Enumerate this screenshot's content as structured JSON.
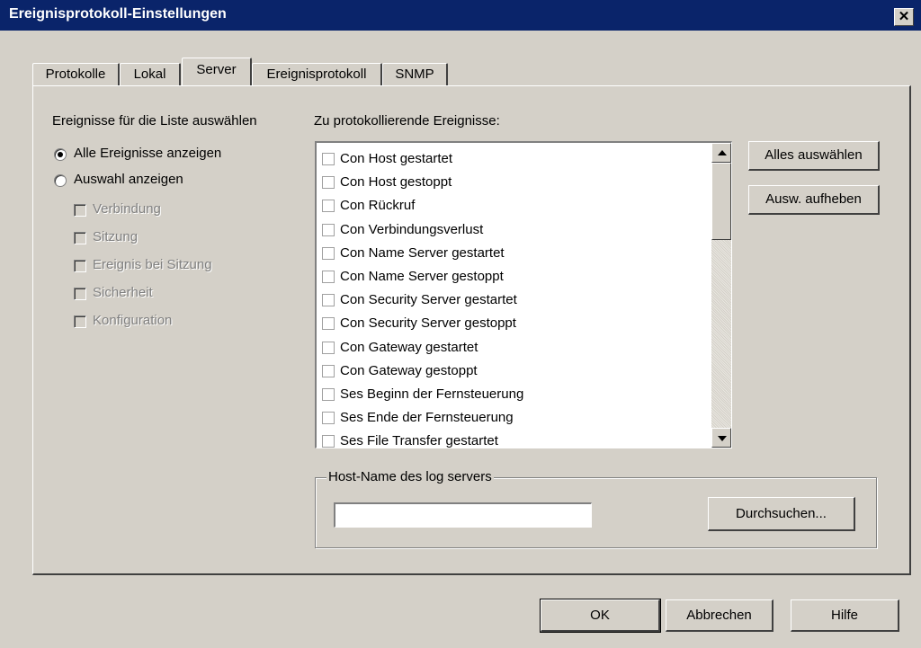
{
  "window": {
    "title": "Ereignisprotokoll-Einstellungen",
    "close_glyph": "✕"
  },
  "tabs": [
    {
      "label": "Protokolle"
    },
    {
      "label": "Lokal"
    },
    {
      "label": "Server",
      "active": true
    },
    {
      "label": "Ereignisprotokoll"
    },
    {
      "label": "SNMP"
    }
  ],
  "left": {
    "heading": "Ereignisse für die Liste auswählen",
    "radio_all": "Alle Ereignisse anzeigen",
    "radio_selection": "Auswahl anzeigen",
    "selected_radio": "all",
    "categories": [
      "Verbindung",
      "Sitzung",
      "Ereignis bei Sitzung",
      "Sicherheit",
      "Konfiguration"
    ]
  },
  "events": {
    "heading": "Zu protokollierende Ereignisse:",
    "items": [
      "Con Host gestartet",
      "Con Host gestoppt",
      "Con Rückruf",
      "Con Verbindungsverlust",
      "Con Name Server gestartet",
      "Con Name Server gestoppt",
      "Con Security Server gestartet",
      "Con Security Server gestoppt",
      "Con Gateway gestartet",
      "Con Gateway gestoppt",
      "Ses Beginn der Fernsteuerung",
      "Ses Ende der Fernsteuerung",
      "Ses File Transfer gestartet"
    ],
    "select_all_label": "Alles auswählen",
    "deselect_label": "Ausw. aufheben"
  },
  "log_server": {
    "group_label": "Host-Name des log servers",
    "value": "",
    "browse_label": "Durchsuchen..."
  },
  "footer": {
    "ok_label": "OK",
    "cancel_label": "Abbrechen",
    "help_label": "Hilfe"
  },
  "colors": {
    "titlebar": "#0a246a",
    "face": "#d4d0c8"
  }
}
